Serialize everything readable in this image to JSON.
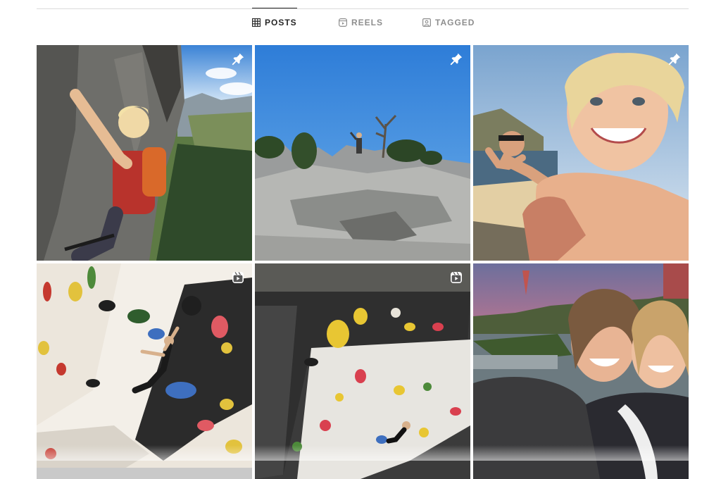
{
  "tabs": [
    {
      "label": "POSTS",
      "icon": "grid-icon",
      "active": true
    },
    {
      "label": "REELS",
      "icon": "reels-icon",
      "active": false
    },
    {
      "label": "TAGGED",
      "icon": "tagged-icon",
      "active": false
    }
  ],
  "posts": [
    {
      "subject": "climber on rock face with mountain valley",
      "badge": "pin-icon"
    },
    {
      "subject": "hiker on granite summit under blue sky",
      "badge": "pin-icon"
    },
    {
      "subject": "smiling selfie on paddleboard with friend",
      "badge": "pin-icon"
    },
    {
      "subject": "climber on indoor bouldering wall",
      "badge": "reel-icon"
    },
    {
      "subject": "climber on bouldering wall in gym",
      "badge": "reel-icon"
    },
    {
      "subject": "two friends selfie at sunset",
      "badge": "none"
    }
  ],
  "colors": {
    "active_tab": "#262626",
    "inactive_tab": "#8e8e8e",
    "divider": "#dbdbdb",
    "badge": "#ffffff"
  }
}
